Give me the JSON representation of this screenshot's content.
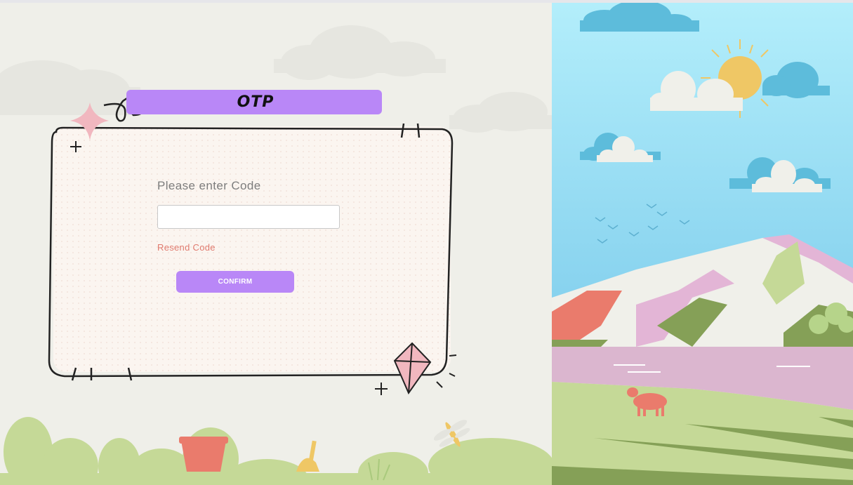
{
  "header": {
    "title": "OTP"
  },
  "form": {
    "prompt": "Please enter Code",
    "code_value": "",
    "resend_label": "Resend Code",
    "confirm_label": "CONFIRM"
  },
  "colors": {
    "accent": "#b987f7",
    "resend": "#e07a6e",
    "background": "#efefe9",
    "card": "#fbf5f0"
  },
  "decorations": {
    "left": [
      "cloud-icon",
      "sparkle-icon",
      "scribble-icon",
      "kite-icon",
      "bush-icon",
      "bucket-icon",
      "shovel-icon",
      "dragonfly-icon"
    ],
    "right": [
      "sun-icon",
      "cloud-icon",
      "bird-icon",
      "mountain-icon",
      "lake-icon",
      "cow-icon",
      "tree-icon"
    ]
  }
}
